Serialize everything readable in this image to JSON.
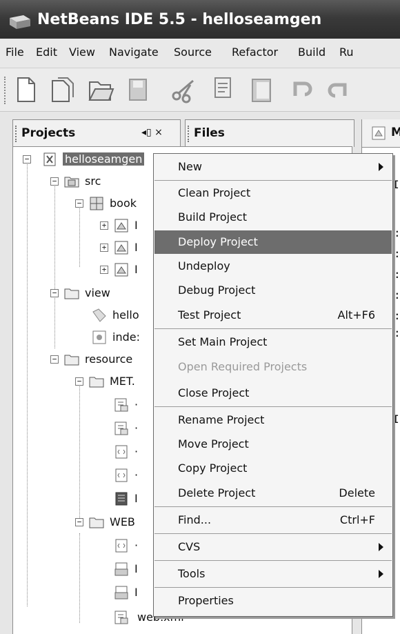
{
  "window": {
    "title": "NetBeans IDE 5.5 - helloseamgen"
  },
  "menubar": {
    "items": [
      "File",
      "Edit",
      "View",
      "Navigate",
      "Source",
      "Refactor",
      "Build",
      "Ru"
    ]
  },
  "toolbar": {
    "icons": [
      "new-file-icon",
      "new-project-icon",
      "open-project-icon",
      "save-all-icon",
      "cut-icon",
      "copy-icon",
      "paste-icon",
      "undo-icon",
      "redo-icon"
    ]
  },
  "tabs": {
    "projects": "Projects",
    "projects_controls": "◂▯ ×",
    "files": "Files",
    "editor": "M"
  },
  "tree": {
    "root": "helloseamgen",
    "src": "src",
    "book": "book",
    "pkg_i1": "I",
    "pkg_i2": "I",
    "pkg_i3": "I",
    "view": "view",
    "hello": "hello",
    "index": "inde:",
    "resources": "resource",
    "meta": "MET.",
    "meta_c1": "·",
    "meta_c2": "·",
    "meta_c3": "·",
    "meta_c4": "·",
    "meta_c5": "I",
    "web": "WEB",
    "web_c1": "·",
    "web_c2": "I",
    "web_c3": "I",
    "webxml": "web.xml"
  },
  "context_menu": {
    "items": [
      {
        "label": "New",
        "submenu": true
      },
      {
        "label": "Clean Project"
      },
      {
        "label": "Build Project"
      },
      {
        "label": "Deploy Project",
        "highlighted": true
      },
      {
        "label": "Undeploy"
      },
      {
        "label": "Debug Project"
      },
      {
        "label": "Test Project",
        "shortcut": "Alt+F6"
      },
      {
        "label": "Set Main Project"
      },
      {
        "label": "Open Required Projects",
        "disabled": true
      },
      {
        "label": "Close Project"
      },
      {
        "label": "Rename Project"
      },
      {
        "label": "Move Project"
      },
      {
        "label": "Copy Project"
      },
      {
        "label": "Delete Project",
        "shortcut": "Delete"
      },
      {
        "label": "Find...",
        "shortcut": "Ctrl+F"
      },
      {
        "label": "CVS",
        "submenu": true
      },
      {
        "label": "Tools",
        "submenu": true
      },
      {
        "label": "Properties"
      }
    ]
  },
  "editor_gutter": {
    "marks": [
      "I",
      ":",
      ":",
      ":",
      ":",
      ":",
      ":",
      "I"
    ]
  },
  "colors": {
    "highlight": "#6d6d6d",
    "titlebar": "#3a3a3a",
    "menu_bg": "#f5f5f5"
  }
}
